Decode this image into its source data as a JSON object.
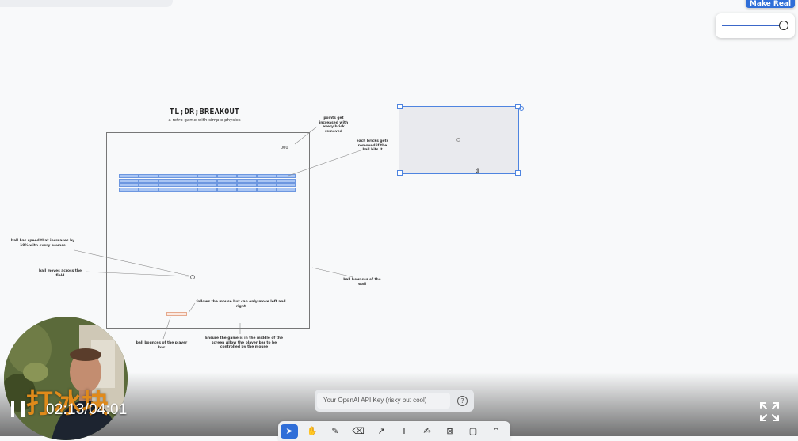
{
  "top_button": {
    "label": "Make Real"
  },
  "zoom": {
    "level": 1.0
  },
  "canvas": {
    "title": "TL;DR;BREAKOUT",
    "subtitle": "a retro game with simple physics",
    "score": "000",
    "notes": {
      "points": "points get increased with every brick removed",
      "bricks": "each bricks gets removed if the ball hits it",
      "speed": "ball has speed that increases by 10% with every bounce",
      "moves": "ball moves across the field",
      "wall": "ball bounces of the wall",
      "mouse": "follows the mouse but can only move left and right",
      "player": "ball bounces of the player bar",
      "ensure": "Ensure the game is in the middle of the screen Allow the player bar to be controlled by the mouse"
    }
  },
  "api_key": {
    "placeholder": "Your OpenAI API Key (risky but cool)",
    "help_symbol": "?"
  },
  "toolbar": {
    "tools": [
      {
        "icon": "select-arrow-icon",
        "glyph": "➤"
      },
      {
        "icon": "hand-icon",
        "glyph": "✋"
      },
      {
        "icon": "pencil-icon",
        "glyph": "✎"
      },
      {
        "icon": "eraser-icon",
        "glyph": "⌫"
      },
      {
        "icon": "arrow-icon",
        "glyph": "↗"
      },
      {
        "icon": "text-icon",
        "glyph": "T"
      },
      {
        "icon": "note-icon",
        "glyph": "✍"
      },
      {
        "icon": "image-icon",
        "glyph": "⊠"
      },
      {
        "icon": "rectangle-icon",
        "glyph": "▢"
      },
      {
        "icon": "chevron-up-icon",
        "glyph": "⌃"
      }
    ]
  },
  "video": {
    "time": "02:13/04:01"
  },
  "overlay": {
    "watermark": "打冰块"
  },
  "colors": {
    "accent": "#2f6ed8",
    "selection": "#4e84e0",
    "brick": "#a9c5f3",
    "watermark": "#e08a1a"
  }
}
